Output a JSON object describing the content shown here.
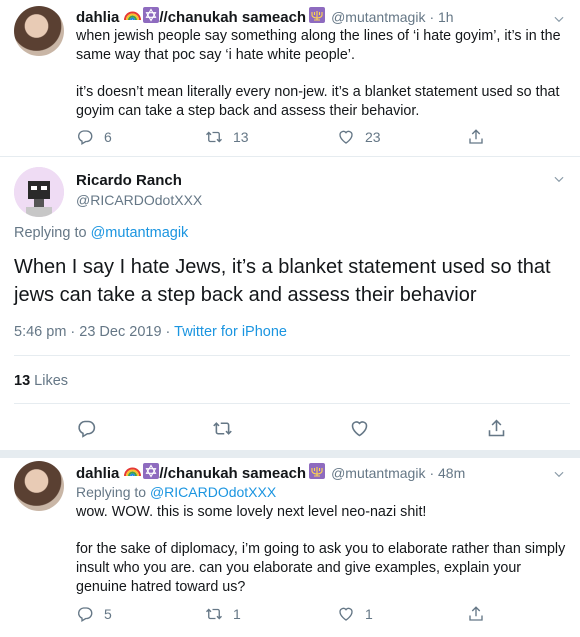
{
  "tweet1": {
    "display_name": "dahlia",
    "name_suffix": "//chanukah sameach",
    "handle": "@mutantmagik",
    "time": "· 1h",
    "paragraph1": "when jewish people say something along the lines of ‘i hate goyim’, it’s in the same way that poc say ‘i hate white people’.",
    "paragraph2": "it’s doesn’t mean literally every non-jew. it’s a blanket statement used so that goyim can take a step back and assess their behavior.",
    "replies": "6",
    "retweets": "13",
    "likes": "23"
  },
  "tweet2": {
    "display_name": "Ricardo Ranch",
    "handle": "@RICARDOdotXXX",
    "replying_prefix": "Replying to ",
    "replying_to": "@mutantmagik",
    "text": "When I say I hate Jews, it’s a blanket statement used so that jews can take a step back and assess their behavior",
    "timestamp": "5:46 pm · 23 Dec 2019 · ",
    "source": "Twitter for iPhone",
    "like_count": "13",
    "like_label": " Likes"
  },
  "tweet3": {
    "display_name": "dahlia",
    "name_suffix": "//chanukah sameach",
    "handle": "@mutantmagik",
    "time": "· 48m",
    "replying_prefix": "Replying to ",
    "replying_to": "@RICARDOdotXXX",
    "paragraph1": "wow. WOW. this is some lovely next level neo-nazi shit!",
    "paragraph2": "for the sake of diplomacy, i’m going to ask you to elaborate rather than simply insult who you are. can you elaborate and give examples, explain your genuine hatred toward us?",
    "replies": "5",
    "retweets": "1",
    "likes": "1"
  },
  "icons": {
    "reply": "reply-icon",
    "retweet": "retweet-icon",
    "like": "heart-icon",
    "share": "share-icon",
    "more": "chevron-down-icon"
  },
  "colors": {
    "link": "#1b95e0",
    "muted": "#657786",
    "divider": "#e6ecf0"
  }
}
